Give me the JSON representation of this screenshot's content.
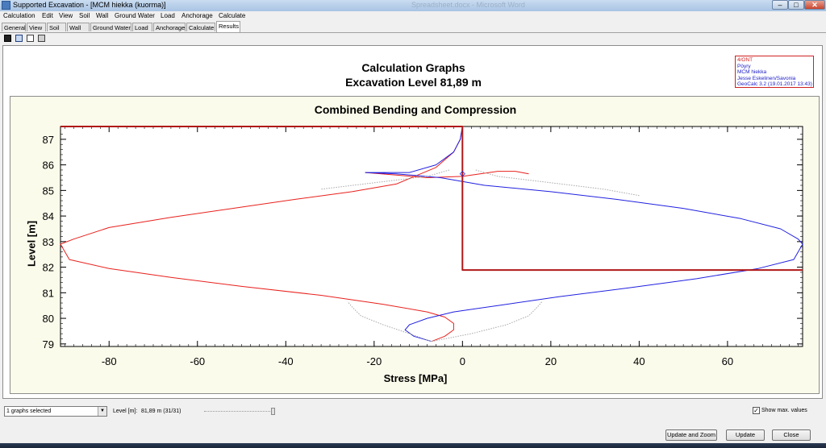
{
  "window": {
    "title": "Supported Excavation - [MCM hiekka (kuorma)]",
    "background_title": "Spreadsheet.docx - Microsoft Word",
    "minimize_glyph": "–",
    "maximize_glyph": "□",
    "close_glyph": "✕"
  },
  "menu": [
    "Calculation",
    "Edit",
    "View",
    "Soil",
    "Wall",
    "Ground Water",
    "Load",
    "Anchorage",
    "Calculate"
  ],
  "tabs": [
    "General",
    "View",
    "Soil",
    "Wall",
    "Ground Water",
    "Load",
    "Anchorage",
    "Calculate",
    "Results"
  ],
  "active_tab": "Results",
  "toolbar_icons": [
    "save-icon",
    "copy-icon",
    "print-preview-icon",
    "print-icon"
  ],
  "report": {
    "title": "Calculation Graphs",
    "subtitle": "Excavation Level 81,89 m",
    "info_lines": [
      "4/ONT",
      "Pöyry",
      "MCM hiekka",
      "Jesse Eskelinen/Savonia",
      "GeoCalc 3.2 (19.01.2017 13:43)"
    ]
  },
  "chart_data": {
    "type": "line",
    "title": "Combined Bending and Compression",
    "xlabel": "Stress [MPa]",
    "ylabel": "Level [m]",
    "xlim": [
      -91,
      77
    ],
    "ylim": [
      78.9,
      87.5
    ],
    "xticks": [
      -80,
      -60,
      -40,
      -20,
      0,
      20,
      40,
      60
    ],
    "yticks": [
      79,
      80,
      81,
      82,
      83,
      84,
      85,
      86,
      87
    ],
    "grid": false,
    "series": [
      {
        "color": "#e8201c",
        "style": "solid",
        "points": [
          [
            0,
            87.5
          ],
          [
            -0.5,
            87.0
          ],
          [
            -2,
            86.5
          ],
          [
            -6,
            85.9
          ],
          [
            -15,
            85.25
          ],
          [
            -25,
            84.95
          ],
          [
            -38,
            84.65
          ],
          [
            -52,
            84.3
          ],
          [
            -66,
            83.95
          ],
          [
            -80,
            83.55
          ],
          [
            -88,
            83.1
          ],
          [
            -91,
            82.9
          ],
          [
            -89,
            82.3
          ],
          [
            -80,
            81.95
          ],
          [
            -66,
            81.6
          ],
          [
            -50,
            81.25
          ],
          [
            -32,
            80.9
          ],
          [
            -18,
            80.55
          ],
          [
            -8,
            80.25
          ],
          [
            -4,
            80.05
          ],
          [
            -2,
            79.8
          ],
          [
            -2,
            79.55
          ],
          [
            -4,
            79.3
          ],
          [
            -7,
            79.1
          ]
        ]
      },
      {
        "color": "#e8201c",
        "style": "solid",
        "points": [
          [
            -22,
            85.7
          ],
          [
            -15,
            85.6
          ],
          [
            -8,
            85.5
          ],
          [
            0,
            85.55
          ],
          [
            8,
            85.75
          ],
          [
            12,
            85.75
          ],
          [
            15,
            85.65
          ]
        ]
      },
      {
        "color": "#2020e0",
        "style": "solid",
        "points": [
          [
            0,
            87.5
          ],
          [
            -0.5,
            87.0
          ],
          [
            -2,
            86.5
          ],
          [
            -6,
            86.0
          ],
          [
            -12,
            85.7
          ],
          [
            -22,
            85.7
          ],
          [
            -15,
            85.65
          ],
          [
            -5,
            85.5
          ],
          [
            5,
            85.2
          ],
          [
            20,
            84.95
          ],
          [
            35,
            84.65
          ],
          [
            50,
            84.3
          ],
          [
            63,
            83.9
          ],
          [
            72,
            83.5
          ],
          [
            76,
            83.1
          ],
          [
            77,
            82.9
          ],
          [
            75,
            82.3
          ],
          [
            67,
            81.95
          ],
          [
            53,
            81.55
          ],
          [
            38,
            81.2
          ],
          [
            22,
            80.85
          ],
          [
            8,
            80.5
          ],
          [
            -2,
            80.25
          ],
          [
            -8,
            80.0
          ],
          [
            -12,
            79.75
          ],
          [
            -13,
            79.55
          ],
          [
            -11,
            79.3
          ],
          [
            -7,
            79.1
          ]
        ]
      },
      {
        "color": "#a8a8a8",
        "style": "dotted",
        "points": [
          [
            -3,
            85.8
          ],
          [
            -8,
            85.55
          ],
          [
            -20,
            85.3
          ],
          [
            -32,
            85.05
          ]
        ]
      },
      {
        "color": "#a8a8a8",
        "style": "dotted",
        "points": [
          [
            3,
            85.8
          ],
          [
            8,
            85.55
          ],
          [
            20,
            85.3
          ],
          [
            32,
            85.05
          ],
          [
            40,
            84.8
          ]
        ]
      },
      {
        "color": "#a8a8a8",
        "style": "dotted",
        "points": [
          [
            -7,
            79.1
          ],
          [
            -12,
            79.4
          ],
          [
            -18,
            79.75
          ],
          [
            -23,
            80.1
          ],
          [
            -25,
            80.45
          ],
          [
            -26,
            80.65
          ]
        ]
      },
      {
        "color": "#a8a8a8",
        "style": "dotted",
        "points": [
          [
            -7,
            79.1
          ],
          [
            2,
            79.4
          ],
          [
            10,
            79.75
          ],
          [
            15,
            80.1
          ],
          [
            17,
            80.45
          ],
          [
            18,
            80.65
          ]
        ]
      },
      {
        "color": "#b01818",
        "style": "heavy",
        "points": [
          [
            -91,
            87.5
          ],
          [
            0,
            87.5
          ],
          [
            0,
            81.89
          ],
          [
            77,
            81.89
          ]
        ]
      }
    ],
    "markers": [
      {
        "x": 0,
        "y": 85.65,
        "color": "#2020e0"
      }
    ]
  },
  "controls": {
    "graphs_combo_value": "1 graphs selected",
    "level_label": "Level [m]:",
    "level_value": "81,89 m (31/31)",
    "level_slider_fraction": 1.0,
    "show_max_label": "Show max. values",
    "show_max_checked": true
  },
  "buttons": {
    "update_zoom": "Update and Zoom",
    "update": "Update",
    "close": "Close"
  }
}
